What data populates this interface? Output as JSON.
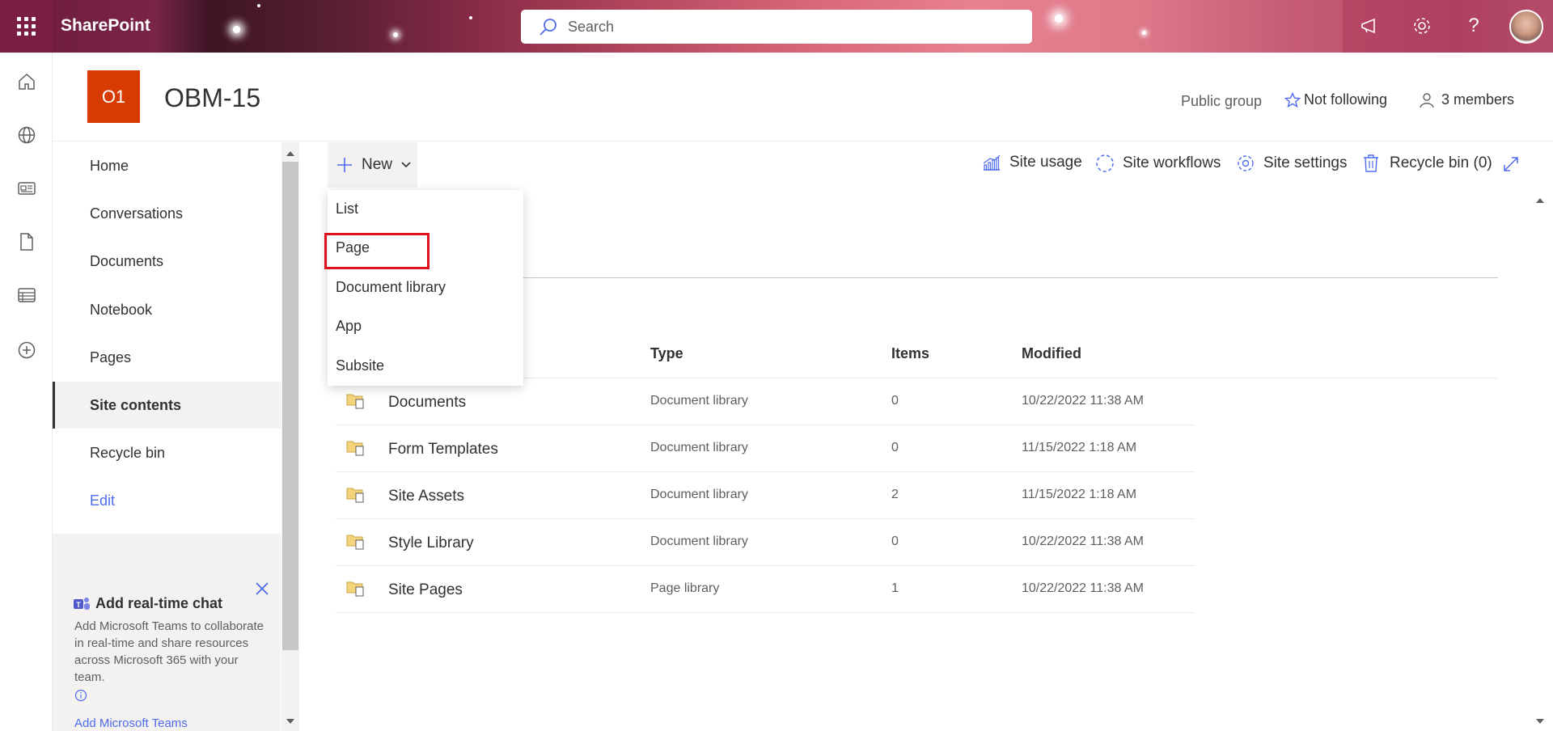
{
  "suite": {
    "app_name": "SharePoint",
    "search_placeholder": "Search"
  },
  "site": {
    "logo_text": "O1",
    "title": "OBM-15",
    "privacy": "Public group",
    "follow": "Not following",
    "members": "3 members"
  },
  "leftnav": {
    "items": [
      {
        "label": "Home"
      },
      {
        "label": "Conversations"
      },
      {
        "label": "Documents"
      },
      {
        "label": "Notebook"
      },
      {
        "label": "Pages"
      },
      {
        "label": "Site contents"
      },
      {
        "label": "Recycle bin"
      }
    ],
    "edit": "Edit",
    "chat": {
      "title": "Add real-time chat",
      "body": "Add Microsoft Teams to collaborate in real-time and share resources across Microsoft 365 with your team.",
      "link": "Add Microsoft Teams"
    }
  },
  "commandbar": {
    "new_label": "New",
    "site_usage": "Site usage",
    "site_workflows": "Site workflows",
    "site_settings": "Site settings",
    "recycle_bin": "Recycle bin (0)"
  },
  "new_menu": {
    "items": [
      "List",
      "Page",
      "Document library",
      "App",
      "Subsite"
    ]
  },
  "table": {
    "headers": {
      "type": "Type",
      "items": "Items",
      "modified": "Modified"
    },
    "rows": [
      {
        "name": "Documents",
        "type": "Document library",
        "items": "0",
        "modified": "10/22/2022 11:38 AM"
      },
      {
        "name": "Form Templates",
        "type": "Document library",
        "items": "0",
        "modified": "11/15/2022 1:18 AM"
      },
      {
        "name": "Site Assets",
        "type": "Document library",
        "items": "2",
        "modified": "11/15/2022 1:18 AM"
      },
      {
        "name": "Style Library",
        "type": "Document library",
        "items": "0",
        "modified": "10/22/2022 11:38 AM"
      },
      {
        "name": "Site Pages",
        "type": "Page library",
        "items": "1",
        "modified": "10/22/2022 11:38 AM"
      }
    ]
  },
  "colors": {
    "brand_logo": "#d83b01",
    "highlight": "#e0101c",
    "link": "#4f6bed"
  }
}
